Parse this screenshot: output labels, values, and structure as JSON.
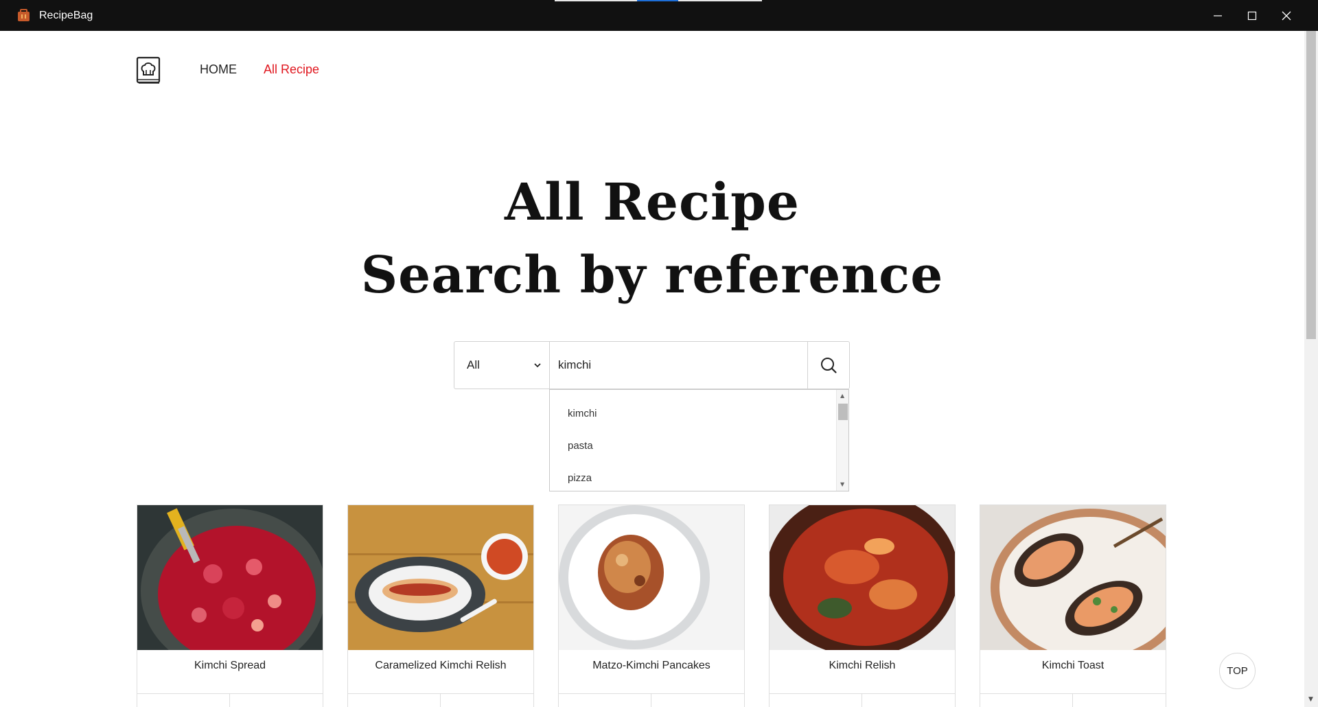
{
  "window": {
    "title": "RecipeBag"
  },
  "nav": {
    "home": "HOME",
    "all_recipe": "All Recipe"
  },
  "hero": {
    "line1": "All Recipe",
    "line2": "Search by reference"
  },
  "search": {
    "category": "All",
    "query": "kimchi",
    "suggestions": [
      "kimchi",
      "pasta",
      "pizza"
    ]
  },
  "cards": [
    {
      "title": "Kimchi Spread"
    },
    {
      "title": "Caramelized Kimchi Relish"
    },
    {
      "title": "Matzo-Kimchi Pancakes"
    },
    {
      "title": "Kimchi Relish"
    },
    {
      "title": "Kimchi Toast"
    }
  ],
  "top_button": "TOP",
  "colors": {
    "accent": "#e0161e",
    "titlebar": "#111111"
  },
  "icons": [
    "recipebag-app-icon",
    "chef-book-logo-icon",
    "chevron-down-icon",
    "search-icon",
    "minimize-icon",
    "maximize-icon",
    "close-icon"
  ]
}
